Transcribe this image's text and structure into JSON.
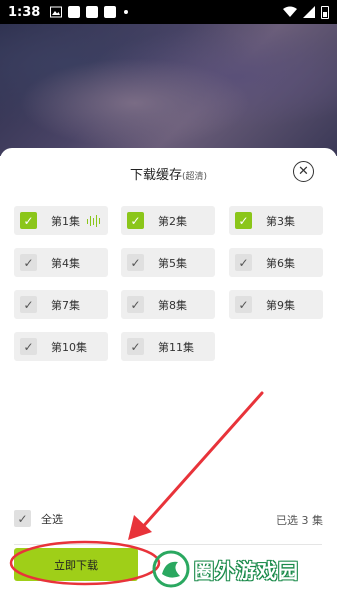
{
  "status_bar": {
    "time": "1:38"
  },
  "sheet": {
    "title": "下载缓存",
    "title_sub": "(超清)",
    "close_icon": "close-icon"
  },
  "episodes": [
    {
      "label": "第1集",
      "checked": true,
      "playing": true
    },
    {
      "label": "第2集",
      "checked": true,
      "playing": false
    },
    {
      "label": "第3集",
      "checked": true,
      "playing": false
    },
    {
      "label": "第4集",
      "checked": false,
      "playing": false
    },
    {
      "label": "第5集",
      "checked": false,
      "playing": false
    },
    {
      "label": "第6集",
      "checked": false,
      "playing": false
    },
    {
      "label": "第7集",
      "checked": false,
      "playing": false
    },
    {
      "label": "第8集",
      "checked": false,
      "playing": false
    },
    {
      "label": "第9集",
      "checked": false,
      "playing": false
    },
    {
      "label": "第10集",
      "checked": false,
      "playing": false
    },
    {
      "label": "第11集",
      "checked": false,
      "playing": false
    }
  ],
  "footer": {
    "select_all_label": "全选",
    "selected_count": "已选 3 集",
    "download_label": "立即下载"
  },
  "watermark": {
    "text": "圈外游戏园"
  },
  "colors": {
    "accent": "#8bc61a",
    "annotation": "#e8333a"
  }
}
